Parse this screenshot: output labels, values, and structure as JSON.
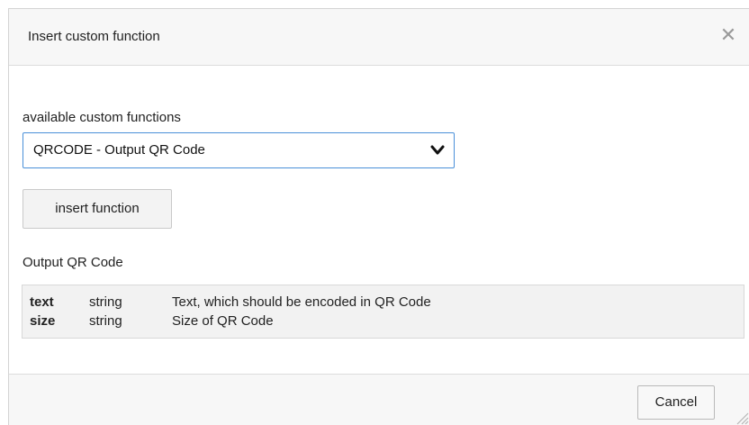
{
  "dialog": {
    "title": "Insert custom function",
    "close_icon": "close-icon"
  },
  "form": {
    "select_label": "available custom functions",
    "selected_function": "QRCODE - Output QR Code",
    "select_icon": "chevron-down-icon",
    "insert_button_label": "insert function",
    "function_description": "Output QR Code"
  },
  "parameters": [
    {
      "name": "text",
      "type": "string",
      "description": "Text, which should be encoded in QR Code"
    },
    {
      "name": "size",
      "type": "string",
      "description": "Size of QR Code"
    }
  ],
  "footer": {
    "cancel_label": "Cancel",
    "resize_icon": "resize-grip-icon"
  },
  "colors": {
    "select_border": "#4a90d9",
    "header_background": "#f7f7f7",
    "table_background": "#f2f2f2"
  }
}
